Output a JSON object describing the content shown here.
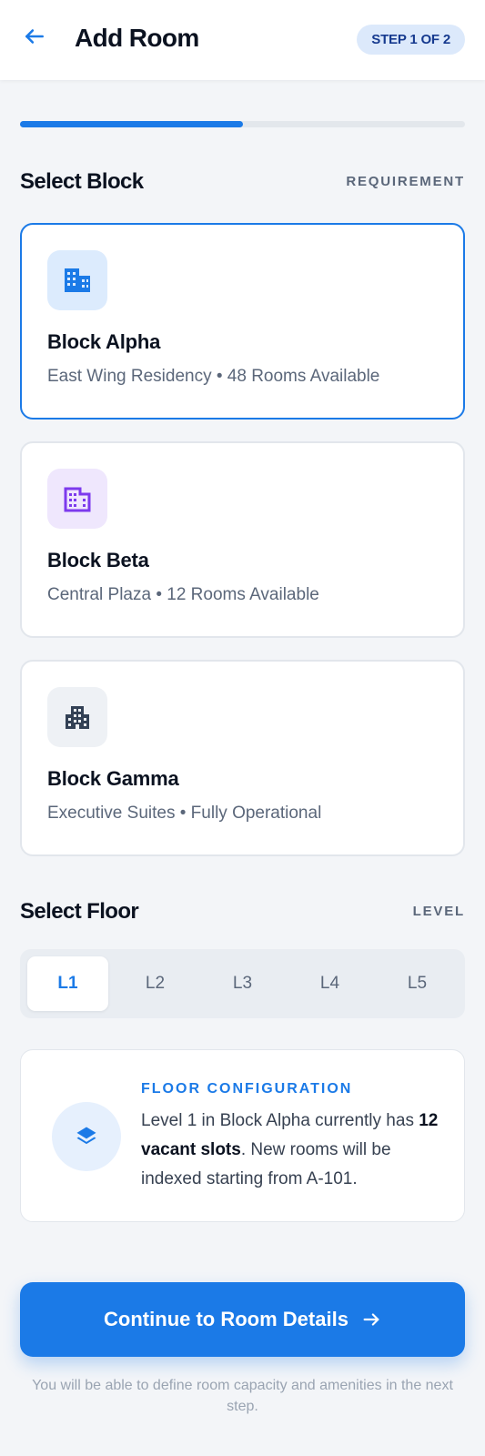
{
  "header": {
    "title": "Add Room",
    "step": "STEP 1 OF 2",
    "back_icon": "arrow-left-icon"
  },
  "progress": {
    "value": 0.5
  },
  "block_section": {
    "title": "Select Block",
    "tag": "REQUIREMENT",
    "blocks": [
      {
        "name": "Block Alpha",
        "desc": "East Wing Residency • 48 Rooms Available",
        "icon": "building-icon",
        "selected": true,
        "accent": "#1b7ae7",
        "icon_bg": "#dcebfd"
      },
      {
        "name": "Block Beta",
        "desc": "Central Plaza • 12 Rooms Available",
        "icon": "office-building-icon",
        "selected": false,
        "accent": "#7c3aed",
        "icon_bg": "#efe7fd"
      },
      {
        "name": "Block Gamma",
        "desc": "Executive Suites • Fully Operational",
        "icon": "apartment-icon",
        "selected": false,
        "accent": "#334155",
        "icon_bg": "#eef1f5"
      }
    ]
  },
  "floor_section": {
    "title": "Select Floor",
    "tag": "LEVEL",
    "floors": [
      "L1",
      "L2",
      "L3",
      "L4",
      "L5"
    ],
    "active": "L1"
  },
  "info": {
    "label": "FLOOR CONFIGURATION",
    "text_before": "Level 1 in Block Alpha currently has ",
    "text_bold": "12 vacant slots",
    "text_after": ". New rooms will be indexed starting from A-101.",
    "icon": "layers-icon"
  },
  "cta": {
    "label": "Continue to Room Details",
    "icon": "arrow-right-icon"
  },
  "footnote": "You will be able to define room capacity and amenities in the next step.",
  "colors": {
    "primary": "#1b7ae7",
    "background": "#f3f5f8"
  }
}
